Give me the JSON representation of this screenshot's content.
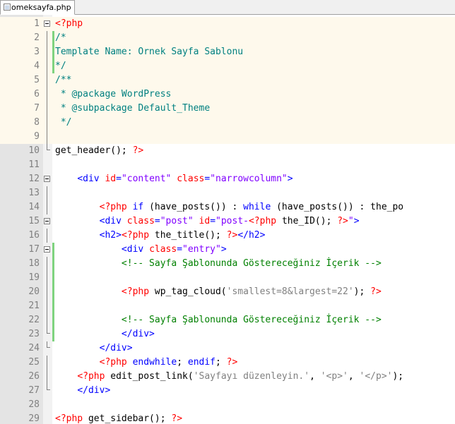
{
  "tab": {
    "filename": "omeksayfa.php"
  },
  "lines": [
    {
      "n": "1",
      "fold": "box",
      "php": true,
      "changed": false,
      "tokens": [
        [
          "php-d",
          "<?php"
        ]
      ]
    },
    {
      "n": "2",
      "fold": "line",
      "php": true,
      "changed": true,
      "tokens": [
        [
          "pcm",
          "/*"
        ]
      ]
    },
    {
      "n": "3",
      "fold": "line",
      "php": true,
      "changed": true,
      "tokens": [
        [
          "pcm",
          "Template Name: Ornek Sayfa Sablonu"
        ]
      ]
    },
    {
      "n": "4",
      "fold": "line",
      "php": true,
      "changed": true,
      "tokens": [
        [
          "pcm",
          "*/"
        ]
      ]
    },
    {
      "n": "5",
      "fold": "line",
      "php": true,
      "changed": false,
      "tokens": [
        [
          "pcm",
          "/**"
        ]
      ]
    },
    {
      "n": "6",
      "fold": "line",
      "php": true,
      "changed": false,
      "tokens": [
        [
          "pcm",
          " * @package WordPress"
        ]
      ]
    },
    {
      "n": "7",
      "fold": "line",
      "php": true,
      "changed": false,
      "tokens": [
        [
          "pcm",
          " * @subpackage Default_Theme"
        ]
      ]
    },
    {
      "n": "8",
      "fold": "line",
      "php": true,
      "changed": false,
      "tokens": [
        [
          "pcm",
          " */"
        ]
      ]
    },
    {
      "n": "9",
      "fold": "line",
      "php": true,
      "changed": false,
      "tokens": []
    },
    {
      "n": "10",
      "fold": "tail",
      "php": false,
      "changed": false,
      "tokens": [
        [
          "dflt",
          "get_header(); "
        ],
        [
          "php-d",
          "?>"
        ]
      ]
    },
    {
      "n": "11",
      "fold": "",
      "php": false,
      "changed": false,
      "tokens": []
    },
    {
      "n": "12",
      "fold": "box",
      "php": false,
      "changed": false,
      "tokens": [
        [
          "dflt",
          "    "
        ],
        [
          "tag",
          "<div "
        ],
        [
          "attr",
          "id"
        ],
        [
          "tag",
          "="
        ],
        [
          "val",
          "\"content\""
        ],
        [
          "tag",
          " "
        ],
        [
          "attr",
          "class"
        ],
        [
          "tag",
          "="
        ],
        [
          "val",
          "\"narrowcolumn\""
        ],
        [
          "tag",
          ">"
        ]
      ]
    },
    {
      "n": "13",
      "fold": "line",
      "php": false,
      "changed": false,
      "tokens": []
    },
    {
      "n": "14",
      "fold": "line",
      "php": false,
      "changed": false,
      "tokens": [
        [
          "dflt",
          "        "
        ],
        [
          "php-d",
          "<?php "
        ],
        [
          "kw",
          "if "
        ],
        [
          "dflt",
          "(have_posts()) : "
        ],
        [
          "kw",
          "while "
        ],
        [
          "dflt",
          "(have_posts()) : the_po"
        ]
      ]
    },
    {
      "n": "15",
      "fold": "box",
      "php": false,
      "changed": false,
      "tokens": [
        [
          "dflt",
          "        "
        ],
        [
          "tag",
          "<div "
        ],
        [
          "attr",
          "class"
        ],
        [
          "tag",
          "="
        ],
        [
          "val",
          "\"post\""
        ],
        [
          "tag",
          " "
        ],
        [
          "attr",
          "id"
        ],
        [
          "tag",
          "="
        ],
        [
          "val",
          "\"post-"
        ],
        [
          "php-d",
          "<?php "
        ],
        [
          "dflt",
          "the_ID(); "
        ],
        [
          "php-d",
          "?>"
        ],
        [
          "val",
          "\""
        ],
        [
          "tag",
          ">"
        ]
      ]
    },
    {
      "n": "16",
      "fold": "line",
      "php": false,
      "changed": false,
      "tokens": [
        [
          "dflt",
          "        "
        ],
        [
          "tag",
          "<h2>"
        ],
        [
          "php-d",
          "<?php "
        ],
        [
          "dflt",
          "the_title(); "
        ],
        [
          "php-d",
          "?>"
        ],
        [
          "tag",
          "</h2>"
        ]
      ]
    },
    {
      "n": "17",
      "fold": "box",
      "php": false,
      "changed": true,
      "tokens": [
        [
          "dflt",
          "            "
        ],
        [
          "tag",
          "<div "
        ],
        [
          "attr",
          "class"
        ],
        [
          "tag",
          "="
        ],
        [
          "val",
          "\"entry\""
        ],
        [
          "tag",
          ">"
        ]
      ]
    },
    {
      "n": "18",
      "fold": "line",
      "php": false,
      "changed": true,
      "tokens": [
        [
          "dflt",
          "            "
        ],
        [
          "cm",
          "<!-- Sayfa Şablonunda Göstereceğiniz İçerik -->"
        ]
      ]
    },
    {
      "n": "19",
      "fold": "line",
      "php": false,
      "changed": true,
      "tokens": []
    },
    {
      "n": "20",
      "fold": "line",
      "php": false,
      "changed": true,
      "tokens": [
        [
          "dflt",
          "            "
        ],
        [
          "php-d",
          "<?php "
        ],
        [
          "dflt",
          "wp_tag_cloud("
        ],
        [
          "str",
          "'smallest=8&largest=22'"
        ],
        [
          "dflt",
          "); "
        ],
        [
          "php-d",
          "?>"
        ]
      ]
    },
    {
      "n": "21",
      "fold": "line",
      "php": false,
      "changed": true,
      "tokens": []
    },
    {
      "n": "22",
      "fold": "line",
      "php": false,
      "changed": true,
      "tokens": [
        [
          "dflt",
          "            "
        ],
        [
          "cm",
          "<!-- Sayfa Şablonunda Göstereceğiniz İçerik -->"
        ]
      ]
    },
    {
      "n": "23",
      "fold": "tail",
      "php": false,
      "changed": true,
      "tokens": [
        [
          "dflt",
          "            "
        ],
        [
          "tag",
          "</div>"
        ]
      ]
    },
    {
      "n": "24",
      "fold": "tail",
      "php": false,
      "changed": false,
      "tokens": [
        [
          "dflt",
          "        "
        ],
        [
          "tag",
          "</div>"
        ]
      ]
    },
    {
      "n": "25",
      "fold": "line",
      "php": false,
      "changed": false,
      "tokens": [
        [
          "dflt",
          "        "
        ],
        [
          "php-d",
          "<?php "
        ],
        [
          "kw",
          "endwhile"
        ],
        [
          "dflt",
          "; "
        ],
        [
          "kw",
          "endif"
        ],
        [
          "dflt",
          "; "
        ],
        [
          "php-d",
          "?>"
        ]
      ]
    },
    {
      "n": "26",
      "fold": "line",
      "php": false,
      "changed": false,
      "tokens": [
        [
          "dflt",
          "    "
        ],
        [
          "php-d",
          "<?php "
        ],
        [
          "dflt",
          "edit_post_link("
        ],
        [
          "str",
          "'Sayfayı düzenleyin.'"
        ],
        [
          "dflt",
          ", "
        ],
        [
          "str",
          "'<p>'"
        ],
        [
          "dflt",
          ", "
        ],
        [
          "str",
          "'</p>'"
        ],
        [
          "dflt",
          ");"
        ]
      ]
    },
    {
      "n": "27",
      "fold": "tail",
      "php": false,
      "changed": false,
      "tokens": [
        [
          "dflt",
          "    "
        ],
        [
          "tag",
          "</div>"
        ]
      ]
    },
    {
      "n": "28",
      "fold": "",
      "php": false,
      "changed": false,
      "tokens": []
    },
    {
      "n": "29",
      "fold": "",
      "php": false,
      "changed": false,
      "tokens": [
        [
          "php-d",
          "<?php "
        ],
        [
          "dflt",
          "get_sidebar(); "
        ],
        [
          "php-d",
          "?>"
        ]
      ]
    }
  ]
}
